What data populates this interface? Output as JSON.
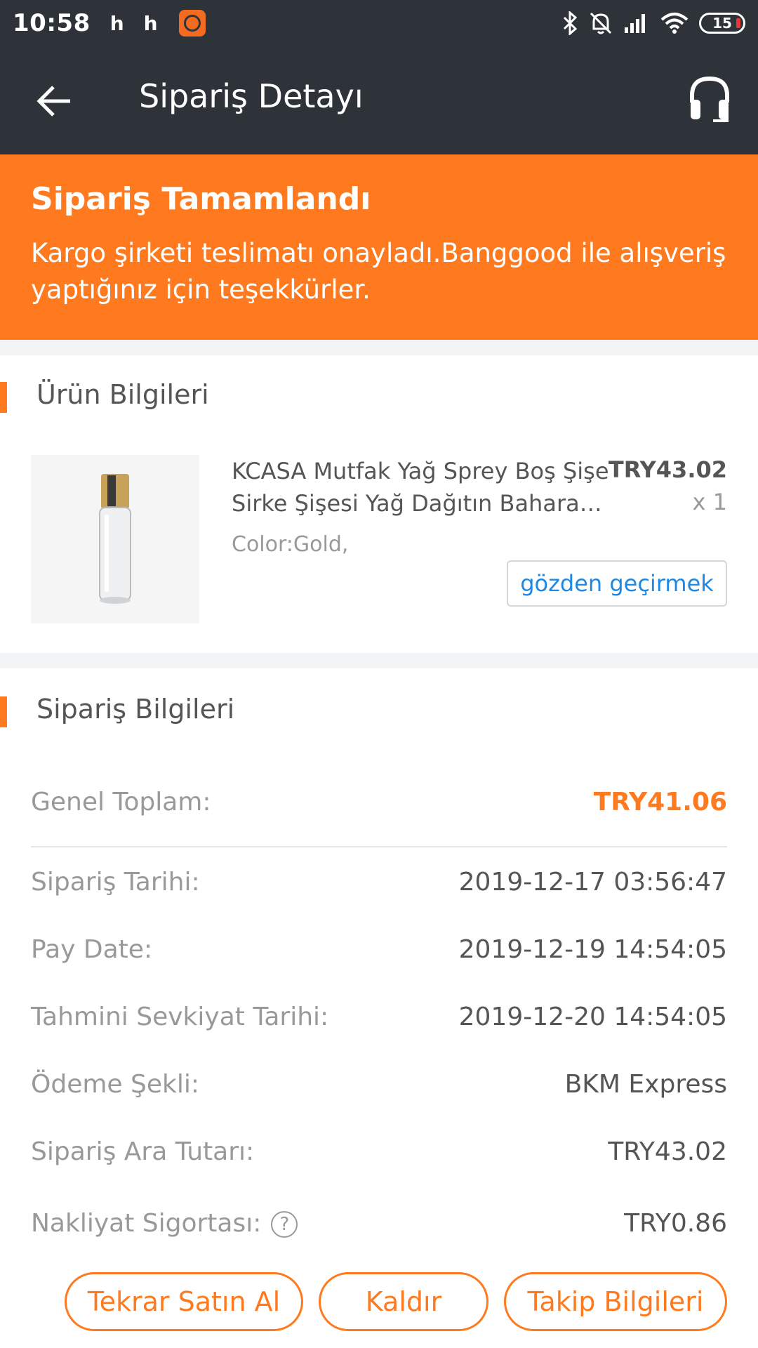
{
  "status_bar": {
    "time": "10:58",
    "notif_letters": [
      "h",
      "h"
    ],
    "battery": "15"
  },
  "app_bar": {
    "title": "Sipariş Detayı"
  },
  "banner": {
    "title": "Sipariş Tamamlandı",
    "message": "Kargo şirketi teslimatı onayladı.Banggood ile alışveriş yaptığınız için teşekkürler."
  },
  "product_section": {
    "title": "Ürün Bilgileri",
    "product": {
      "name_line1": "KCASA Mutfak Yağ Sprey Boş Şişe",
      "name_line2": "Sirke Şişesi Yağ Dağıtın Baharat ...",
      "price": "TRY43.02",
      "quantity": "x 1",
      "color": "Color:Gold,",
      "review_label": "gözden geçirmek"
    }
  },
  "order_section": {
    "title": "Sipariş Bilgileri",
    "total_label": "Genel Toplam:",
    "total_value": "TRY41.06",
    "rows": [
      {
        "label": "Sipariş Tarihi:",
        "value": "2019-12-17 03:56:47"
      },
      {
        "label": "Pay Date:",
        "value": "2019-12-19 14:54:05"
      },
      {
        "label": "Tahmini Sevkiyat Tarihi:",
        "value": "2019-12-20 14:54:05"
      },
      {
        "label": "Ödeme Şekli:",
        "value": "BKM Express"
      },
      {
        "label": "Sipariş Ara Tutarı:",
        "value": "TRY43.02"
      },
      {
        "label": "Nakliyat Sigortası:",
        "value": "TRY0.86"
      }
    ]
  },
  "actions": {
    "buy_again": "Tekrar Satın Al",
    "remove": "Kaldır",
    "tracking": "Takip Bilgileri"
  },
  "colors": {
    "accent": "#ff7a1f",
    "header": "#2d3338",
    "link": "#1e88e5"
  },
  "icons": [
    "back-arrow-icon",
    "headset-icon",
    "bluetooth-icon",
    "mute-icon",
    "signal-icon",
    "wifi-icon",
    "help-icon"
  ]
}
